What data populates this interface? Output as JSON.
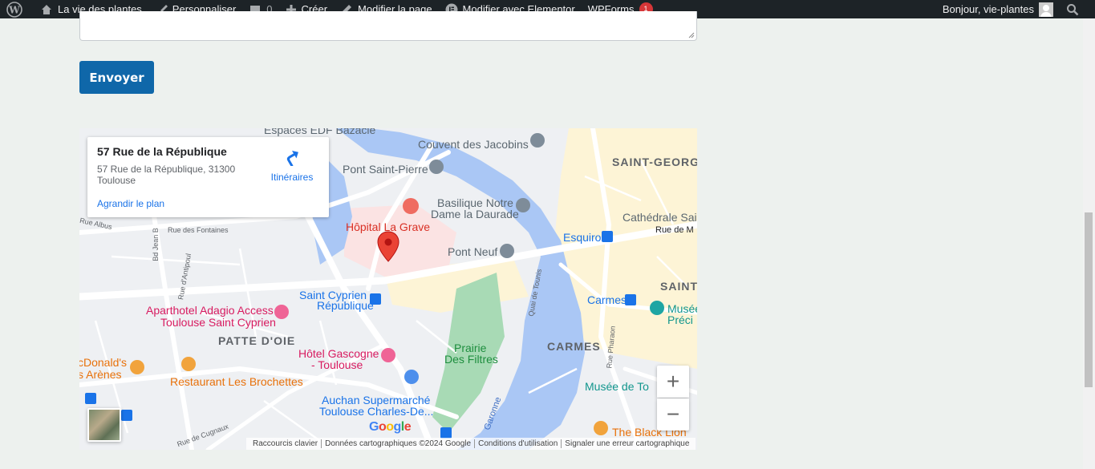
{
  "adminbar": {
    "site_name": "La vie des plantes",
    "customize": "Personnaliser",
    "comments_count": "0",
    "new": "Créer",
    "edit_page": "Modifier la page",
    "elementor": "Modifier avec Elementor",
    "wpforms": "WPForms",
    "wpforms_badge": "1",
    "greeting": "Bonjour, vie-plantes"
  },
  "form": {
    "submit_label": "Envoyer"
  },
  "map": {
    "card": {
      "title": "57 Rue de la République",
      "address": "57 Rue de la République, 31300 Toulouse",
      "directions": "Itinéraires",
      "enlarge": "Agrandir le plan"
    },
    "labels": {
      "espaces_edf": "Espaces EDF Bazacle",
      "couvent": "Couvent des Jacobins",
      "saint_georges": "SAINT-GEORG",
      "pont_saint_pierre": "Pont Saint-Pierre",
      "basilique_1": "Basilique Notre",
      "basilique_2": "Dame la Daurade",
      "cathedrale": "Cathédrale Sain",
      "rue_albus": "Rue Albus",
      "rue_fontaines": "Rue des Fontaines",
      "hopital": "Hôpital La Grave",
      "esquirol": "Esquirol",
      "rue_de_m": "Rue de M",
      "bd_jean": "Bd Jean B",
      "rue_antipoul": "Rue d'Antipoul",
      "pont_neuf": "Pont Neuf",
      "quai_tounis": "Quai de Tounis",
      "saint": "SAINT",
      "saint_cyprien_1": "Saint Cyprien -",
      "saint_cyprien_2": "République",
      "carmes": "Carmes",
      "musee_1": "Musée",
      "musee_2": "Préci",
      "aparthotel_1": "Aparthotel Adagio Access",
      "aparthotel_2": "Toulouse Saint Cyprien",
      "patte_doie": "PATTE D'OIE",
      "carmes_district": "CARMES",
      "rue_pharaon": "Rue Pharaon",
      "mcdonalds_1": "cDonald's",
      "mcdonalds_2": "s Arènes",
      "hotel_gascogne_1": "Hôtel Gascogne",
      "hotel_gascogne_2": "- Toulouse",
      "prairie_1": "Prairie",
      "prairie_2": "Des Filtres",
      "restaurant": "Restaurant Les Brochettes",
      "musee_toulouse": "Musée de To",
      "auchan_1": "Auchan Supermarché",
      "auchan_2": "Toulouse Charles-De...",
      "garonne": "Garonne",
      "rue_cugnaux": "Rue de Cugnaux",
      "black_lion": "The Black Lion"
    },
    "zoom_in": "+",
    "zoom_out": "−",
    "google": "Google",
    "attribution": {
      "shortcuts": "Raccourcis clavier",
      "data": "Données cartographiques ©2024 Google",
      "terms": "Conditions d'utilisation",
      "report": "Signaler une erreur cartographique"
    }
  },
  "colors": {
    "adminbar_bg": "#1d2327",
    "button_bg": "#0f67a9",
    "page_bg": "#edf1ee",
    "water": "#aac7f5",
    "park": "#a8dab5",
    "marker": "#ea4335"
  },
  "icons": [
    "wordpress-icon",
    "brush-icon",
    "comment-icon",
    "plus-icon",
    "pencil-icon",
    "elementor-icon",
    "search-icon",
    "directions-icon",
    "marker-icon"
  ]
}
